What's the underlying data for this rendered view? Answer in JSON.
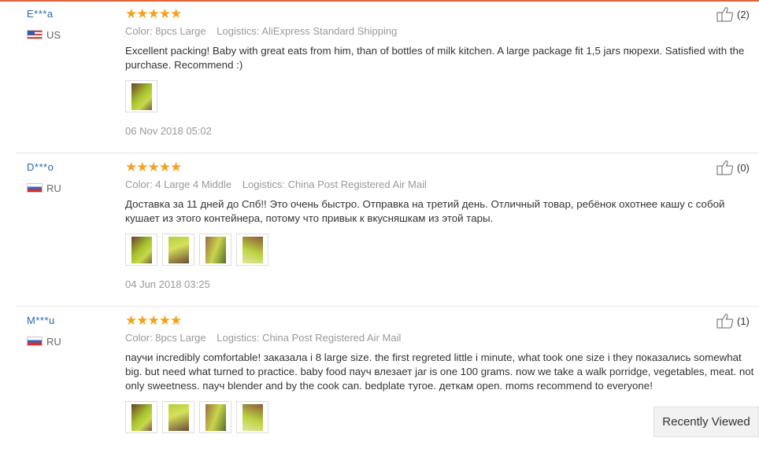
{
  "reviews": [
    {
      "user": "E***a",
      "country": "US",
      "stars": "★★★★★",
      "color_label": "Color: 8pcs Large",
      "logistics_label": "Logistics: AliExpress Standard Shipping",
      "text": "Excellent packing! Baby with great eats from him, than of bottles of milk kitchen. A large package fit 1,5 jars пюрехи. Satisfied with the purchase. Recommend :)",
      "photos": 1,
      "date": "06 Nov 2018 05:02",
      "helpful": "(2)"
    },
    {
      "user": "D***o",
      "country": "RU",
      "stars": "★★★★★",
      "color_label": "Color: 4 Large 4 Middle",
      "logistics_label": "Logistics: China Post Registered Air Mail",
      "text": "Доставка за 11 дней до Спб!! Это очень быстро. Отправка на третий день. Отличный товар, ребёнок охотнее кашу с собой кушает из этого контейнера, потому что привык к вкусняшкам из этой тары.",
      "photos": 4,
      "date": "04 Jun 2018 03:25",
      "helpful": "(0)"
    },
    {
      "user": "M***u",
      "country": "RU",
      "stars": "★★★★★",
      "color_label": "Color: 8pcs Large",
      "logistics_label": "Logistics: China Post Registered Air Mail",
      "text": "паучи incredibly comfortable! заказала i 8 large size. the first regreted little i minute, what took one size i they показались somewhat big. but need what turned to practice. baby food пауч влезает jar is one 100 grams. now we take a walk porridge, vegetables, meat. not only sweetness. пауч blender and by the cook can. bedplate тугое. деткам open. moms recommend to everyone!",
      "photos": 4,
      "date": "",
      "helpful": "(1)"
    }
  ],
  "recently_viewed": "Recently Viewed",
  "colors": {
    "accent": "#e0623a",
    "stars": "#f4a21d",
    "username": "#2865b4"
  }
}
